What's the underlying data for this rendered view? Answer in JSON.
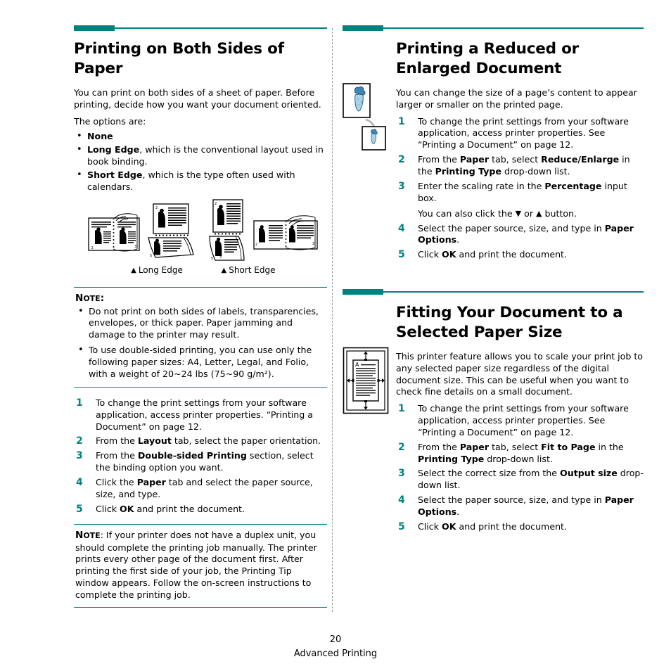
{
  "theme": {
    "accent": "#00827f",
    "text": "#000000",
    "divider": "#9a9a9a"
  },
  "left_column": {
    "heading": "Printing on Both Sides of Paper",
    "intro": "You can print on both sides of a sheet of paper. Before printing, decide how you want your document oriented.",
    "options_lead": "The options are:",
    "bullets": [
      {
        "bold": "None",
        "rest": ""
      },
      {
        "bold": "Long Edge",
        "rest": ", which is the conventional layout used in book binding."
      },
      {
        "bold": "Short Edge",
        "rest": ", which is the type often used with calendars."
      }
    ],
    "figure_captions": {
      "long_edge": "Long Edge",
      "short_edge": "Short Edge",
      "marker": "▲"
    },
    "note_top": {
      "label_first": "N",
      "label_rest": "OTE",
      "label_suffix": ":",
      "bullets": [
        "Do not print on both sides of labels, transparencies, envelopes, or thick paper. Paper jamming and damage to the printer may result.",
        "To use double-sided printing, you can use only the following paper sizes: A4, Letter, Legal, and Folio, with a weight of 20~24 lbs (75~90 g/m²)."
      ]
    },
    "steps": [
      {
        "n": "1",
        "parts": [
          {
            "t": "To change the print settings from your software application, access printer properties. “Printing a Document” on page 12."
          }
        ]
      },
      {
        "n": "2",
        "parts": [
          {
            "t": "From the "
          },
          {
            "t": "Layout",
            "b": true
          },
          {
            "t": " tab, select the paper orientation."
          }
        ]
      },
      {
        "n": "3",
        "parts": [
          {
            "t": "From the "
          },
          {
            "t": "Double-sided Printing",
            "b": true
          },
          {
            "t": " section, select the binding option you want."
          }
        ]
      },
      {
        "n": "4",
        "parts": [
          {
            "t": "Click the "
          },
          {
            "t": "Paper",
            "b": true
          },
          {
            "t": " tab and select the paper source, size, and type."
          }
        ]
      },
      {
        "n": "5",
        "parts": [
          {
            "t": "Click "
          },
          {
            "t": "OK",
            "b": true
          },
          {
            "t": " and print the document."
          }
        ]
      }
    ],
    "note_bottom": {
      "label_first": "N",
      "label_rest": "OTE",
      "text": ": If your printer does not have a duplex unit, you should complete the printing job manually. The printer prints every other page of the document first. After printing the first side of your job, the Printing Tip window appears. Follow the on-screen instructions to complete the printing job."
    }
  },
  "right_column": {
    "section_reduce": {
      "heading": "Printing a Reduced or Enlarged Document",
      "intro": "You can change the size of a page’s content to appear larger or smaller on the printed page.",
      "steps": [
        {
          "n": "1",
          "parts": [
            {
              "t": "To change the print settings from your software application, access printer properties. See “Printing a Document” on page 12."
            }
          ]
        },
        {
          "n": "2",
          "parts": [
            {
              "t": "From the "
            },
            {
              "t": "Paper",
              "b": true
            },
            {
              "t": " tab, select "
            },
            {
              "t": "Reduce/Enlarge",
              "b": true
            },
            {
              "t": " in the "
            },
            {
              "t": "Printing Type",
              "b": true
            },
            {
              "t": " drop-down list."
            }
          ]
        },
        {
          "n": "3",
          "parts": [
            {
              "t": "Enter the scaling rate in the "
            },
            {
              "t": "Percentage",
              "b": true
            },
            {
              "t": " input box."
            }
          ],
          "sub_prefix": "You can also click the ",
          "sub_down": "▼",
          "sub_mid": " or ",
          "sub_up": "▲",
          "sub_suffix": " button."
        },
        {
          "n": "4",
          "parts": [
            {
              "t": "Select the paper source, size, and type in "
            },
            {
              "t": "Paper Options",
              "b": true
            },
            {
              "t": "."
            }
          ]
        },
        {
          "n": "5",
          "parts": [
            {
              "t": "Click "
            },
            {
              "t": "OK",
              "b": true
            },
            {
              "t": " and print the document."
            }
          ]
        }
      ]
    },
    "section_fit": {
      "heading": "Fitting Your Document to a Selected Paper Size",
      "intro": "This printer feature allows you to scale your print job to any selected paper size regardless of the digital document size. This can be useful when you want to check fine details on a small document.",
      "steps": [
        {
          "n": "1",
          "parts": [
            {
              "t": "To change the print settings from your software application, access printer properties. See “Printing a Document” on page 12."
            }
          ]
        },
        {
          "n": "2",
          "parts": [
            {
              "t": "From the "
            },
            {
              "t": "Paper",
              "b": true
            },
            {
              "t": " tab, select "
            },
            {
              "t": "Fit to Page",
              "b": true
            },
            {
              "t": " in the "
            },
            {
              "t": "Printing Type",
              "b": true
            },
            {
              "t": " drop-down list."
            }
          ]
        },
        {
          "n": "3",
          "parts": [
            {
              "t": "Select the correct size from the "
            },
            {
              "t": "Output size",
              "b": true
            },
            {
              "t": " drop-down list."
            }
          ]
        },
        {
          "n": "4",
          "parts": [
            {
              "t": "Select the paper source, size, and type in "
            },
            {
              "t": "Paper Options",
              "b": true
            },
            {
              "t": "."
            }
          ]
        },
        {
          "n": "5",
          "parts": [
            {
              "t": "Click "
            },
            {
              "t": "OK",
              "b": true
            },
            {
              "t": " and print the document."
            }
          ]
        }
      ]
    }
  },
  "footer": {
    "page_number": "20",
    "chapter": "Advanced Printing"
  }
}
